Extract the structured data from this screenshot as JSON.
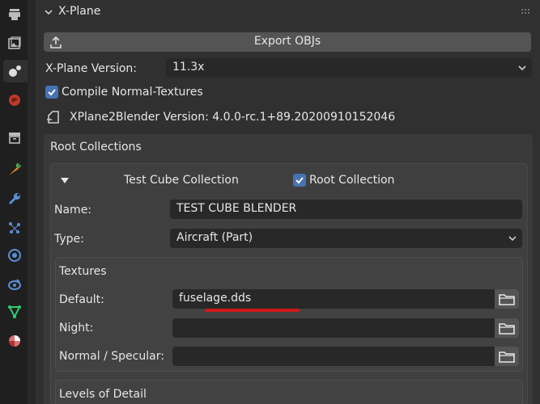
{
  "header": {
    "title": "X-Plane"
  },
  "export_button": {
    "label": "Export OBJs"
  },
  "version": {
    "label": "X-Plane Version:",
    "value": "11.3x"
  },
  "compile": {
    "label": "Compile Normal-Textures",
    "checked": true
  },
  "plugin_version": {
    "text": "XPlane2Blender Version: 4.0.0-rc.1+89.20200910152046"
  },
  "root_collections": {
    "title": "Root Collections"
  },
  "collection": {
    "name_label": "Test Cube Collection",
    "root_label": "Root Collection",
    "root_checked": true,
    "name_field_label": "Name:",
    "name_value": "TEST CUBE BLENDER",
    "type_label": "Type:",
    "type_value": "Aircraft (Part)"
  },
  "textures": {
    "title": "Textures",
    "default_label": "Default:",
    "default_value": "fuselage.dds",
    "night_label": "Night:",
    "night_value": "",
    "normal_label": "Normal / Specular:",
    "normal_value": ""
  },
  "lod": {
    "title": "Levels of Detail"
  },
  "colors": {
    "accent": "#4772b3",
    "highlight": "#d01a1a"
  },
  "sidebar_icons": [
    "tool-icon",
    "render-icon",
    "output-icon",
    "view-layer-icon",
    "scene-icon",
    "world-icon",
    "collection-icon",
    "object-icon",
    "modifier-icon",
    "particles-icon",
    "physics-icon",
    "constraints-icon",
    "data-icon",
    "material-icon"
  ]
}
